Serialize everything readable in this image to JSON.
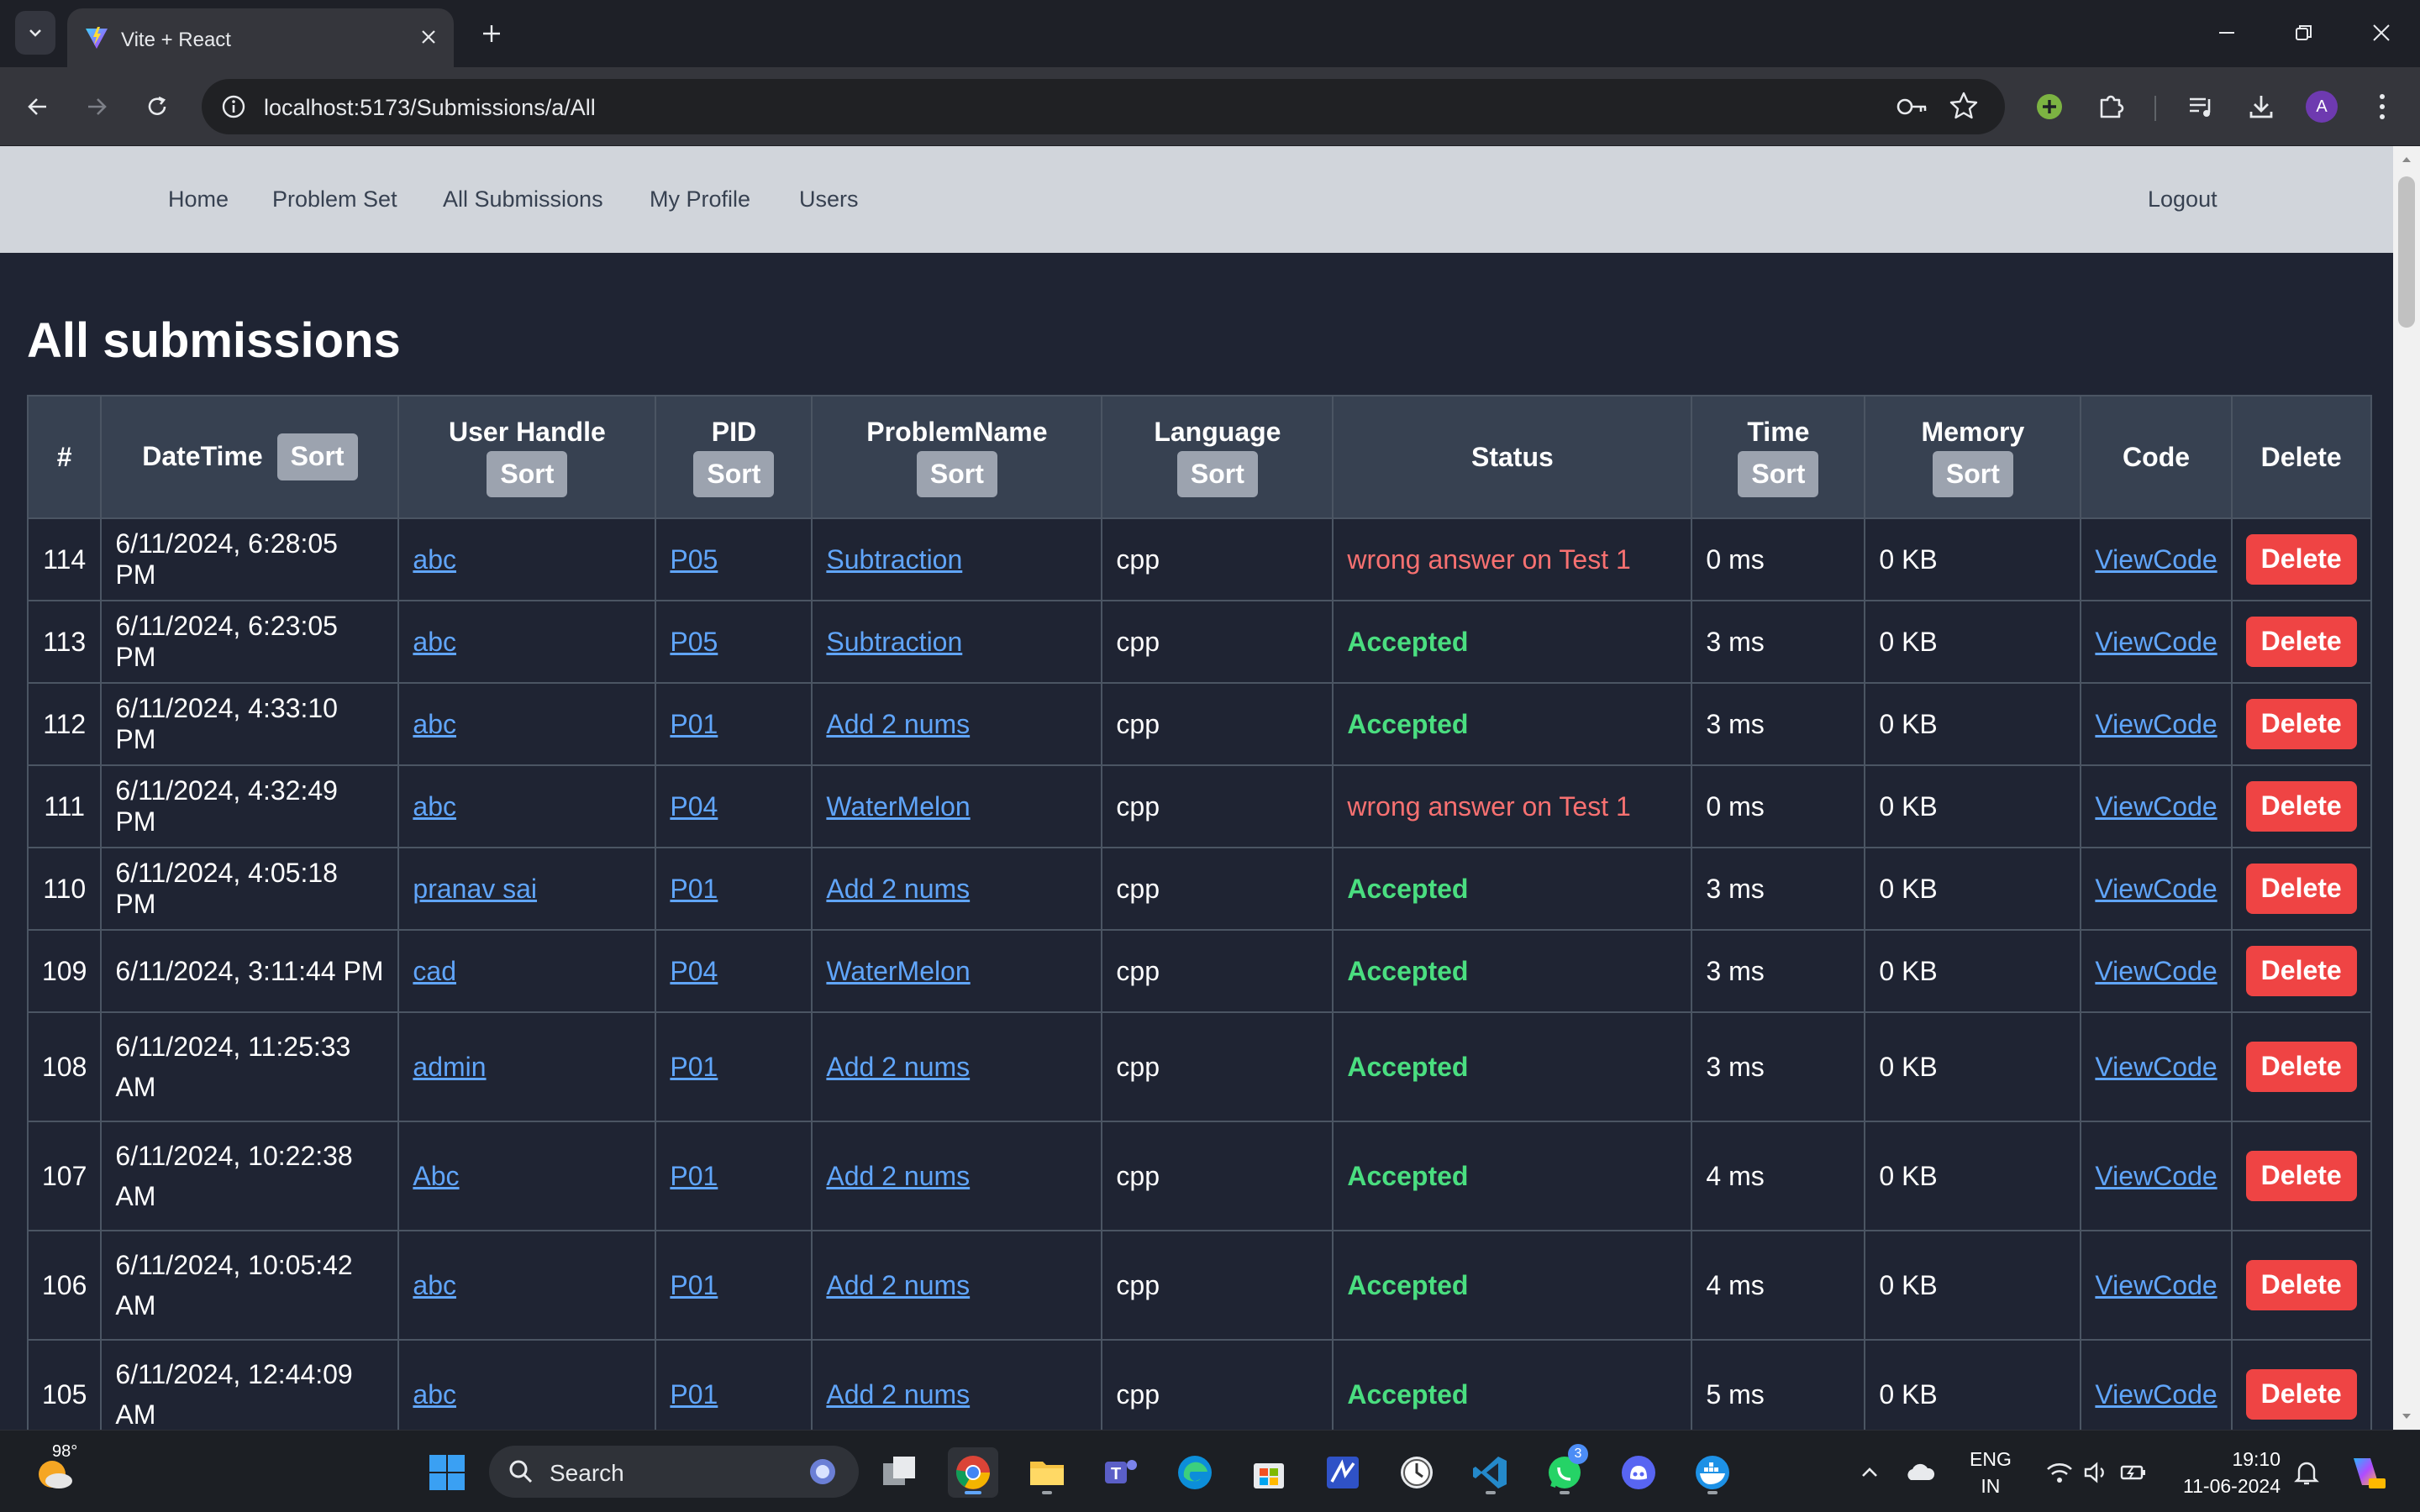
{
  "browser": {
    "tab_title": "Vite + React",
    "url": "localhost:5173/Submissions/a/All",
    "profile_initial": "A"
  },
  "site_nav": {
    "links": [
      "Home",
      "Problem Set",
      "All Submissions",
      "My Profile",
      "Users"
    ],
    "logout": "Logout"
  },
  "page": {
    "title": "All submissions"
  },
  "table": {
    "headers": {
      "num": "#",
      "datetime": "DateTime",
      "user": "User Handle",
      "pid": "PID",
      "problem": "ProblemName",
      "language": "Language",
      "status": "Status",
      "time": "Time",
      "memory": "Memory",
      "code": "Code",
      "delete": "Delete"
    },
    "sort_label": "Sort",
    "view_label": "ViewCode",
    "delete_label": "Delete",
    "rows": [
      {
        "num": "114",
        "datetime": "6/11/2024, 6:28:05 PM",
        "user": "abc",
        "pid": "P05",
        "problem": "Subtraction",
        "lang": "cpp",
        "status": "wrong answer on Test 1",
        "time": "0 ms",
        "memory": "0 KB"
      },
      {
        "num": "113",
        "datetime": "6/11/2024, 6:23:05 PM",
        "user": "abc",
        "pid": "P05",
        "problem": "Subtraction",
        "lang": "cpp",
        "status": "Accepted",
        "time": "3 ms",
        "memory": "0 KB"
      },
      {
        "num": "112",
        "datetime": "6/11/2024, 4:33:10 PM",
        "user": "abc",
        "pid": "P01",
        "problem": "Add 2 nums",
        "lang": "cpp",
        "status": "Accepted",
        "time": "3 ms",
        "memory": "0 KB"
      },
      {
        "num": "111",
        "datetime": "6/11/2024, 4:32:49 PM",
        "user": "abc",
        "pid": "P04",
        "problem": "WaterMelon",
        "lang": "cpp",
        "status": "wrong answer on Test 1",
        "time": "0 ms",
        "memory": "0 KB"
      },
      {
        "num": "110",
        "datetime": "6/11/2024, 4:05:18 PM",
        "user": "pranav sai",
        "pid": "P01",
        "problem": "Add 2 nums",
        "lang": "cpp",
        "status": "Accepted",
        "time": "3 ms",
        "memory": "0 KB"
      },
      {
        "num": "109",
        "datetime": "6/11/2024, 3:11:44 PM",
        "user": "cad",
        "pid": "P04",
        "problem": "WaterMelon",
        "lang": "cpp",
        "status": "Accepted",
        "time": "3 ms",
        "memory": "0 KB"
      },
      {
        "num": "108",
        "datetime": "6/11/2024, 11:25:33 AM",
        "user": "admin",
        "pid": "P01",
        "problem": "Add 2 nums",
        "lang": "cpp",
        "status": "Accepted",
        "time": "3 ms",
        "memory": "0 KB"
      },
      {
        "num": "107",
        "datetime": "6/11/2024, 10:22:38 AM",
        "user": "Abc",
        "pid": "P01",
        "problem": "Add 2 nums",
        "lang": "cpp",
        "status": "Accepted",
        "time": "4 ms",
        "memory": "0 KB"
      },
      {
        "num": "106",
        "datetime": "6/11/2024, 10:05:42 AM",
        "user": "abc",
        "pid": "P01",
        "problem": "Add 2 nums",
        "lang": "cpp",
        "status": "Accepted",
        "time": "4 ms",
        "memory": "0 KB"
      },
      {
        "num": "105",
        "datetime": "6/11/2024, 12:44:09 AM",
        "user": "abc",
        "pid": "P01",
        "problem": "Add 2 nums",
        "lang": "cpp",
        "status": "Accepted",
        "time": "5 ms",
        "memory": "0 KB"
      }
    ]
  },
  "taskbar": {
    "temperature": "98°",
    "search_placeholder": "Search",
    "whatsapp_badge": "3",
    "lang_line1": "ENG",
    "lang_line2": "IN",
    "time": "19:10",
    "date": "11-06-2024"
  },
  "colors": {
    "page_bg": "#1f2433",
    "nav_bg": "#d1d5db",
    "accepted": "#4ade80",
    "wrong": "#f87171",
    "link": "#60a5fa",
    "delete_btn": "#ef4444",
    "sort_btn": "#9ca3af"
  }
}
